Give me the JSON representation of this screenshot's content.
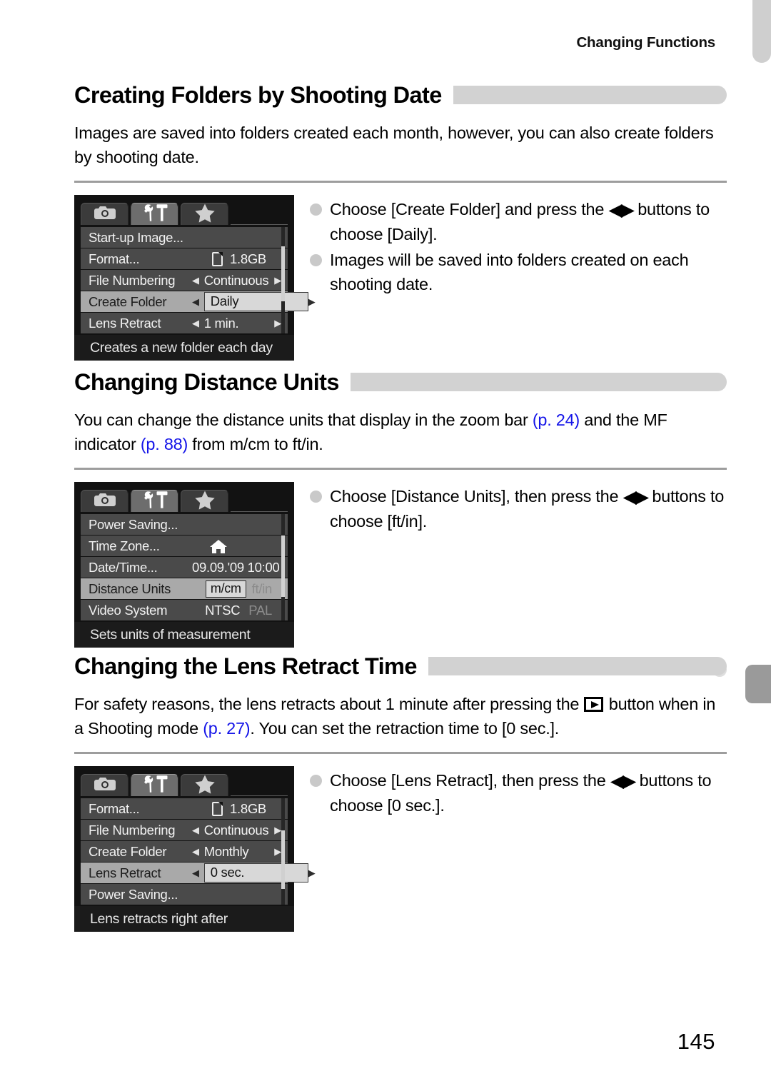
{
  "header": {
    "running_title": "Changing Functions"
  },
  "page_number": "145",
  "colors": {
    "heading_bar": "#d2d2d2",
    "rule": "#9d9d9d",
    "page_ref_link": "#1414e8",
    "bullet_dot": "#c9c9c9",
    "thumb_tab_top": "#cfcfcf",
    "thumb_tab_mid": "#9a9a9a"
  },
  "sections": [
    {
      "title": "Creating Folders by Shooting Date",
      "body": [
        {
          "t": "Images are saved into folders created each month, however, you can also create folders by shooting date."
        }
      ],
      "screen": {
        "tabs": [
          "camera-icon",
          "tools-icon",
          "star-icon"
        ],
        "active_tab_index": 1,
        "rows": [
          {
            "label": "Start-up Image...",
            "value": "",
            "kind": "plain",
            "selected": false
          },
          {
            "label": "Format...",
            "value": "1.8GB",
            "kind": "sd",
            "selected": false
          },
          {
            "label": "File Numbering",
            "value": "Continuous",
            "kind": "stepper",
            "selected": false
          },
          {
            "label": "Create Folder",
            "value": "Daily",
            "kind": "stepper-box",
            "selected": true
          },
          {
            "label": "Lens Retract",
            "value": "1 min.",
            "kind": "stepper",
            "selected": false
          }
        ],
        "hint": "Creates a new folder each day",
        "scroll_top_pct": 18,
        "scroll_height_pct": 52
      },
      "bullets": [
        {
          "pre": "Choose [Create Folder] and press the ",
          "glyph": "left-right-arrows",
          "post": " buttons to choose [Daily]."
        },
        {
          "pre": "Images will be saved into folders created on each shooting date.",
          "glyph": "",
          "post": ""
        }
      ]
    },
    {
      "title": "Changing Distance Units",
      "body": [
        {
          "t": "You can change the distance units that display in the zoom bar "
        },
        {
          "ref": "(p. 24)"
        },
        {
          "t": " and the MF indicator "
        },
        {
          "ref": "(p. 88)"
        },
        {
          "t": " from m/cm to ft/in."
        }
      ],
      "screen": {
        "tabs": [
          "camera-icon",
          "tools-icon",
          "star-icon"
        ],
        "active_tab_index": 1,
        "rows": [
          {
            "label": "Power Saving...",
            "value": "",
            "kind": "plain",
            "selected": false
          },
          {
            "label": "Time Zone...",
            "value": "home-icon",
            "kind": "icon",
            "selected": false
          },
          {
            "label": "Date/Time...",
            "value": "09.09.'09 10:00",
            "kind": "plain-right",
            "selected": false
          },
          {
            "label": "Distance Units",
            "value": "m/cm",
            "value2": "ft/in",
            "kind": "toggle",
            "selected": true
          },
          {
            "label": "Video System",
            "value": "NTSC",
            "value2": "PAL",
            "kind": "toggle-plain",
            "selected": false
          }
        ],
        "hint": "Sets units of measurement",
        "scroll_top_pct": 20,
        "scroll_height_pct": 58
      },
      "bullets": [
        {
          "pre": "Choose [Distance Units], then press the ",
          "glyph": "left-right-arrows",
          "post": " buttons to choose [ft/in]."
        }
      ]
    },
    {
      "title": "Changing the Lens Retract Time",
      "body": [
        {
          "t": "For safety reasons, the lens retracts about 1 minute after pressing the "
        },
        {
          "glyph": "playback-button"
        },
        {
          "t": " button when in a Shooting mode "
        },
        {
          "ref": "(p. 27)"
        },
        {
          "t": ". You can set the retraction time to [0 sec.]."
        }
      ],
      "screen": {
        "tabs": [
          "camera-icon",
          "tools-icon",
          "star-icon"
        ],
        "active_tab_index": 1,
        "rows": [
          {
            "label": "Format...",
            "value": "1.8GB",
            "kind": "sd",
            "selected": false
          },
          {
            "label": "File Numbering",
            "value": "Continuous",
            "kind": "stepper",
            "selected": false
          },
          {
            "label": "Create Folder",
            "value": "Monthly",
            "kind": "stepper",
            "selected": false
          },
          {
            "label": "Lens Retract",
            "value": "0 sec.",
            "kind": "stepper-box",
            "selected": true
          },
          {
            "label": "Power Saving...",
            "value": "",
            "kind": "plain",
            "selected": false
          }
        ],
        "hint": "Lens retracts right after",
        "scroll_top_pct": 30,
        "scroll_height_pct": 55
      },
      "bullets": [
        {
          "pre": "Choose [Lens Retract], then press the ",
          "glyph": "left-right-arrows",
          "post": " buttons to choose [0 sec.]."
        }
      ]
    }
  ]
}
